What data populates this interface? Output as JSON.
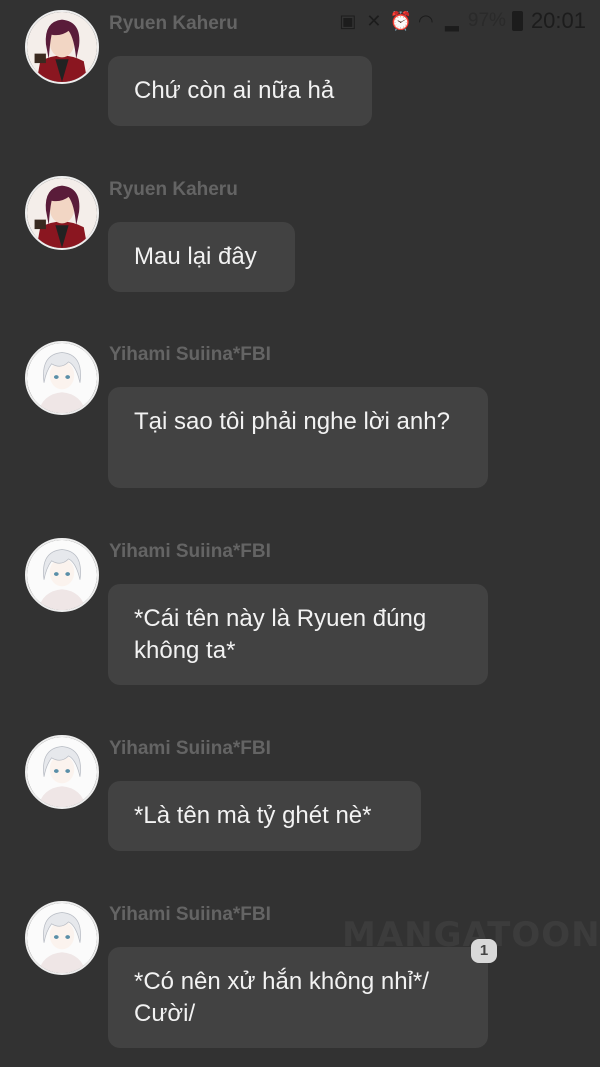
{
  "status_bar": {
    "battery_percent": "97%",
    "time": "20:01",
    "icons": [
      "notification-icon",
      "mute-icon",
      "alarm-icon",
      "wifi-icon",
      "signal-icon",
      "battery-icon"
    ]
  },
  "messages": [
    {
      "sender": "Ryuen Kaheru",
      "avatar": "red-hair-character-avatar",
      "text": "Chứ còn ai nữa hả"
    },
    {
      "sender": "Ryuen Kaheru",
      "avatar": "red-hair-character-avatar",
      "text": "Mau lại đây"
    },
    {
      "sender": "Yihami Suiina*FBI",
      "avatar": "white-hair-character-avatar",
      "text": "Tại sao tôi phải nghe lời anh?"
    },
    {
      "sender": "Yihami Suiina*FBI",
      "avatar": "white-hair-character-avatar",
      "text": "*Cái tên này là Ryuen đúng không ta*"
    },
    {
      "sender": "Yihami Suiina*FBI",
      "avatar": "white-hair-character-avatar",
      "text": "*Là tên mà tỷ ghét nè*"
    },
    {
      "sender": "Yihami Suiina*FBI",
      "avatar": "white-hair-character-avatar",
      "text": "*Có nên xử hắn không nhỉ*/ Cười/"
    }
  ],
  "watermark": "MANGATOON",
  "badge": "1"
}
